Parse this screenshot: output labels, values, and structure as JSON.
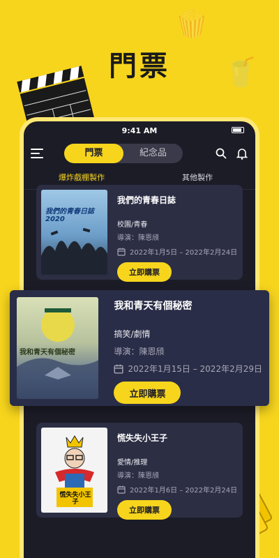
{
  "hero": {
    "title": "門票"
  },
  "status_bar": {
    "time": "9:41 AM"
  },
  "appbar": {
    "tabs": [
      {
        "label": "門票",
        "active": true
      },
      {
        "label": "紀念品",
        "active": false
      }
    ]
  },
  "subtabs": [
    {
      "label": "爆炸戲棚製作",
      "active": true
    },
    {
      "label": "其他製作",
      "active": false
    }
  ],
  "shows": [
    {
      "title": "我們的青春日誌",
      "genre": "校園/青春",
      "director": "導演：陳恩頎",
      "dates": "2022年1月5日 – 2022年2月24日",
      "button": "立即購票",
      "poster_text": "我們的青春日誌 2020"
    },
    {
      "title": "我和青天有個秘密",
      "genre": "搞笑/劇情",
      "director": "導演：陳恩頎",
      "dates": "2022年1月15日 – 2022年2月29日",
      "button": "立即購票",
      "poster_text": "我和青天有個秘密"
    },
    {
      "title": "慌失失小王子",
      "genre": "愛情/推理",
      "director": "導演：陳恩頎",
      "dates": "2022年1月6日 – 2022年2月24日",
      "button": "立即購票",
      "poster_text": "慌失失小王子"
    }
  ],
  "colors": {
    "accent": "#f7d51d",
    "phone_bg": "#1c1c27",
    "card_bg": "#2c2e44"
  }
}
